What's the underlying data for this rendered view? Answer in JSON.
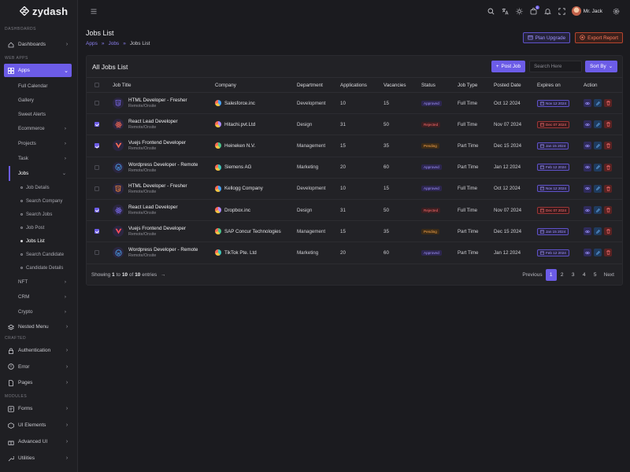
{
  "app": {
    "name": "zydash"
  },
  "sidebar": {
    "sections": {
      "dashboards": "DASHBOARDS",
      "web_apps": "WEB APPS",
      "crafted": "CRAFTED",
      "modules": "MODULES"
    },
    "dashboards": "Dashboards",
    "apps": "Apps",
    "app_items": [
      "Full Calendar",
      "Gallery",
      "Sweet Alerts",
      "Ecommerce",
      "Projects",
      "Task",
      "Jobs"
    ],
    "jobs_items": [
      "Job Details",
      "Search Company",
      "Search Jobs",
      "Job Post",
      "Jobs List",
      "Search Candidate",
      "Candidate Details"
    ],
    "more_apps": [
      "NFT",
      "CRM",
      "Crypto"
    ],
    "nested_menu": "Nested Menu",
    "crafted_items": [
      "Authentication",
      "Error",
      "Pages"
    ],
    "module_items": [
      "Forms",
      "UI Elements",
      "Advanced UI",
      "Utilities"
    ]
  },
  "topbar": {
    "notification_count": "5",
    "user_name": "Mr. Jack"
  },
  "page": {
    "title": "Jobs List",
    "breadcrumb": [
      "Apps",
      "Jobs",
      "Jobs List"
    ],
    "plan_upgrade": "Plan Upgrade",
    "export_report": "Export Report"
  },
  "card": {
    "title": "All Jobs List",
    "post_job": "Post Job",
    "search_placeholder": "Search Here",
    "sort_by": "Sort By"
  },
  "table": {
    "columns": [
      "Job Title",
      "Company",
      "Department",
      "Applications",
      "Vacancies",
      "Status",
      "Job Type",
      "Posted Date",
      "Expires on",
      "Action"
    ],
    "rows": [
      {
        "checked": false,
        "icon": "html5-icon",
        "icon_color": "#7c6cf0",
        "title": "HTML Developer - Fresher",
        "location": "Remote/Onsite",
        "company": "Salesforce.inc",
        "company_logo": "salesforce-logo-icon",
        "logo_color": "#4aa3f5",
        "department": "Development",
        "applications": "10",
        "vacancies": "15",
        "status": "Approved",
        "status_kind": "approved",
        "job_type": "Full Time",
        "posted": "Oct 12 2024",
        "expires": "Nov 12 2024",
        "expires_kind": "approved"
      },
      {
        "checked": true,
        "icon": "react-icon",
        "icon_color": "#ff6b55",
        "title": "React Lead Developer",
        "location": "Remote/Onsite",
        "company": "Hitachi.pvt.Ltd",
        "company_logo": "hitachi-logo-icon",
        "logo_color": "#b18cff",
        "department": "Design",
        "applications": "31",
        "vacancies": "50",
        "status": "Rejected",
        "status_kind": "rejected",
        "job_type": "Full Time",
        "posted": "Nov 07 2024",
        "expires": "Dec 07 2024",
        "expires_kind": "rejected"
      },
      {
        "checked": true,
        "icon": "vuejs-icon",
        "icon_color": "#ff6b55",
        "title": "Vuejs Frontend Developer",
        "location": "Remote/Onsite",
        "company": "Heineken N.V.",
        "company_logo": "heineken-logo-icon",
        "logo_color": "#4cc38a",
        "department": "Management",
        "applications": "15",
        "vacancies": "35",
        "status": "Pending",
        "status_kind": "pending",
        "job_type": "Part Time",
        "posted": "Dec 15 2024",
        "expires": "Jan 15 2024",
        "expires_kind": "approved"
      },
      {
        "checked": false,
        "icon": "wordpress-icon",
        "icon_color": "#4aa3f5",
        "title": "Wordpress Developer - Remote",
        "location": "Remote/Onsite",
        "company": "Siemens AG",
        "company_logo": "siemens-logo-icon",
        "logo_color": "#41c7b9",
        "department": "Marketing",
        "applications": "20",
        "vacancies": "60",
        "status": "Approved",
        "status_kind": "approved",
        "job_type": "Part Time",
        "posted": "Jan 12 2024",
        "expires": "Feb 12 2024",
        "expires_kind": "approved"
      },
      {
        "checked": false,
        "icon": "html5-icon",
        "icon_color": "#ff8a3c",
        "title": "HTML Developer - Fresher",
        "location": "Remote/Onsite",
        "company": "Kellogg Company",
        "company_logo": "kellogg-logo-icon",
        "logo_color": "#4aa3f5",
        "department": "Development",
        "applications": "10",
        "vacancies": "15",
        "status": "Approved",
        "status_kind": "approved",
        "job_type": "Full Time",
        "posted": "Oct 12 2024",
        "expires": "Nov 12 2024",
        "expires_kind": "approved"
      },
      {
        "checked": true,
        "icon": "react-icon",
        "icon_color": "#7c6cf0",
        "title": "React Lead Developer",
        "location": "Remote/Onsite",
        "company": "Dropbox.inc",
        "company_logo": "dropbox-logo-icon",
        "logo_color": "#b18cff",
        "department": "Design",
        "applications": "31",
        "vacancies": "50",
        "status": "Rejected",
        "status_kind": "rejected",
        "job_type": "Full Time",
        "posted": "Nov 07 2024",
        "expires": "Dec 07 2024",
        "expires_kind": "rejected"
      },
      {
        "checked": true,
        "icon": "vuejs-icon",
        "icon_color": "#ff4d5e",
        "title": "Vuejs Frontend Developer",
        "location": "Remote/Onsite",
        "company": "SAP Concur Technologies",
        "company_logo": "sap-logo-icon",
        "logo_color": "#4cc38a",
        "department": "Management",
        "applications": "15",
        "vacancies": "35",
        "status": "Pending",
        "status_kind": "pending",
        "job_type": "Part Time",
        "posted": "Dec 15 2024",
        "expires": "Jan 15 2024",
        "expires_kind": "approved"
      },
      {
        "checked": false,
        "icon": "wordpress-icon",
        "icon_color": "#4aa3f5",
        "title": "Wordpress Developer - Remote",
        "location": "Remote/Onsite",
        "company": "TikTok Pte. Ltd",
        "company_logo": "tiktok-logo-icon",
        "logo_color": "#41c7b9",
        "department": "Marketing",
        "applications": "20",
        "vacancies": "60",
        "status": "Approved",
        "status_kind": "approved",
        "job_type": "Part Time",
        "posted": "Jan 12 2024",
        "expires": "Feb 12 2024",
        "expires_kind": "approved"
      }
    ]
  },
  "footer": {
    "showing": "Showing",
    "from": "1",
    "to_word": "to",
    "to": "10",
    "of_word": "of",
    "total": "10",
    "entries": "entries",
    "previous": "Previous",
    "pages": [
      "1",
      "2",
      "3",
      "4",
      "5"
    ],
    "next": "Next"
  },
  "colors": {
    "accent": "#6c5ce7",
    "danger": "#ff6b55",
    "background": "#1b1b1f"
  }
}
